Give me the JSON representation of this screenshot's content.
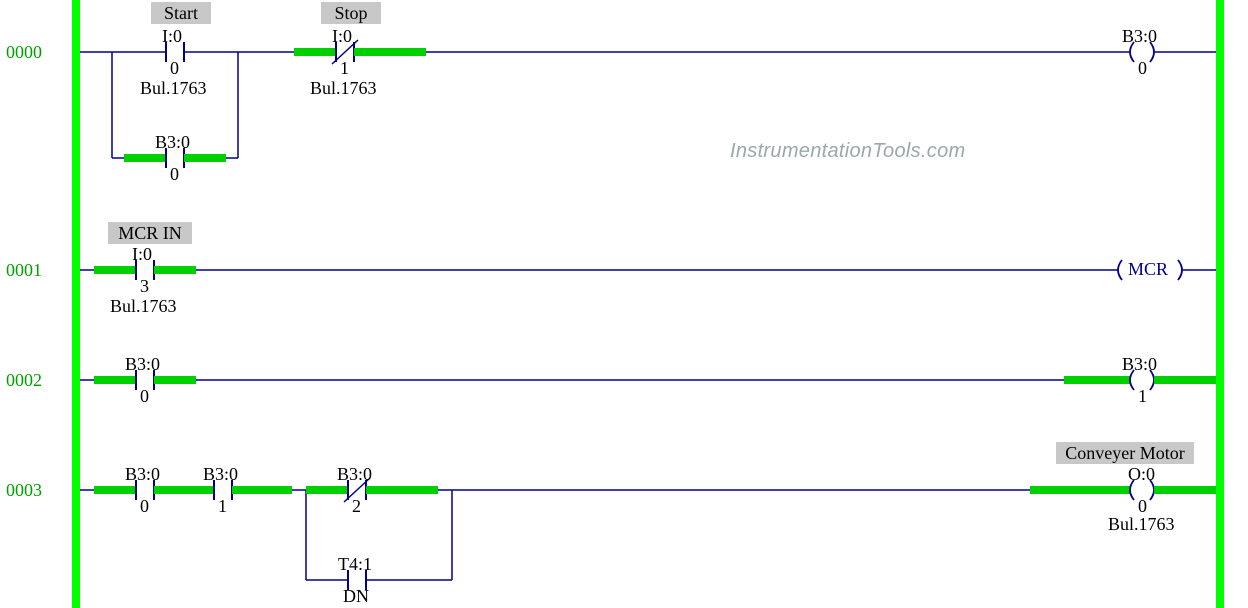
{
  "watermark": "InstrumentationTools.com",
  "rung_numbers": [
    "0000",
    "0001",
    "0002",
    "0003"
  ],
  "rung0": {
    "start": {
      "desc": "Start",
      "addr": "I:0",
      "bit": "0",
      "device": "Bul.1763"
    },
    "stop": {
      "desc": "Stop",
      "addr": "I:0",
      "bit": "1",
      "device": "Bul.1763"
    },
    "seal": {
      "addr": "B3:0",
      "bit": "0"
    },
    "coil": {
      "addr": "B3:0",
      "bit": "0"
    }
  },
  "rung1": {
    "mcr_in": {
      "desc": "MCR IN",
      "addr": "I:0",
      "bit": "3",
      "device": "Bul.1763"
    },
    "coil_label": "MCR"
  },
  "rung2": {
    "xic": {
      "addr": "B3:0",
      "bit": "0"
    },
    "coil": {
      "addr": "B3:0",
      "bit": "1"
    }
  },
  "rung3": {
    "xic1": {
      "addr": "B3:0",
      "bit": "0"
    },
    "xic2": {
      "addr": "B3:0",
      "bit": "1"
    },
    "xio": {
      "addr": "B3:0",
      "bit": "2"
    },
    "tmr": {
      "addr": "T4:1",
      "bit": "DN"
    },
    "coil": {
      "desc": "Conveyer Motor",
      "addr": "O:0",
      "bit": "0",
      "device": "Bul.1763"
    }
  }
}
